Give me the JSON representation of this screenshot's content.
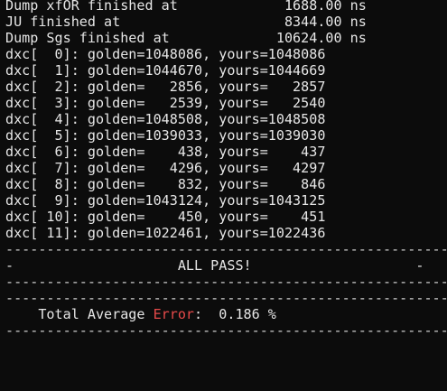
{
  "status_lines": [
    "Dump xfOR finished at             1688.00 ns",
    "JU finished at                    8344.00 ns",
    "Dump Sgs finished at             10624.00 ns"
  ],
  "dxc_rows": [
    "dxc[  0]: golden=1048086, yours=1048086",
    "dxc[  1]: golden=1044670, yours=1044669",
    "dxc[  2]: golden=   2856, yours=   2857",
    "dxc[  3]: golden=   2539, yours=   2540",
    "dxc[  4]: golden=1048508, yours=1048508",
    "dxc[  5]: golden=1039033, yours=1039030",
    "dxc[  6]: golden=    438, yours=    437",
    "dxc[  7]: golden=   4296, yours=   4297",
    "dxc[  8]: golden=    832, yours=    846",
    "dxc[  9]: golden=1043124, yours=1043125",
    "dxc[ 10]: golden=    450, yours=    451",
    "dxc[ 11]: golden=1022461, yours=1022436"
  ],
  "separator": "--------------------------------------------------------------------",
  "pass_line": "-                    ALL PASS!                    -",
  "error_summary": {
    "prefix": "    Total Average ",
    "error_word": "Error",
    "suffix": ":  0.186 %"
  },
  "colors": {
    "background": "#0c0c0c",
    "text": "#e6e6e6",
    "error_word": "#e84a4a"
  }
}
